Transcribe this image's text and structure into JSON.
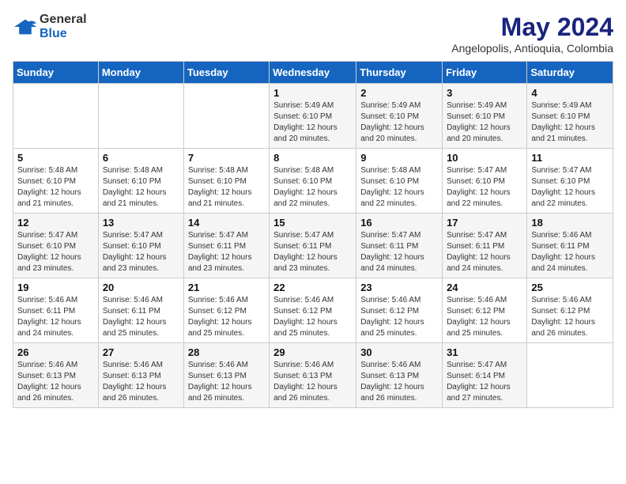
{
  "header": {
    "logo_general": "General",
    "logo_blue": "Blue",
    "month_title": "May 2024",
    "location": "Angelopolis, Antioquia, Colombia"
  },
  "weekdays": [
    "Sunday",
    "Monday",
    "Tuesday",
    "Wednesday",
    "Thursday",
    "Friday",
    "Saturday"
  ],
  "weeks": [
    [
      {
        "day": "",
        "sunrise": "",
        "sunset": "",
        "daylight": ""
      },
      {
        "day": "",
        "sunrise": "",
        "sunset": "",
        "daylight": ""
      },
      {
        "day": "",
        "sunrise": "",
        "sunset": "",
        "daylight": ""
      },
      {
        "day": "1",
        "sunrise": "Sunrise: 5:49 AM",
        "sunset": "Sunset: 6:10 PM",
        "daylight": "Daylight: 12 hours and 20 minutes."
      },
      {
        "day": "2",
        "sunrise": "Sunrise: 5:49 AM",
        "sunset": "Sunset: 6:10 PM",
        "daylight": "Daylight: 12 hours and 20 minutes."
      },
      {
        "day": "3",
        "sunrise": "Sunrise: 5:49 AM",
        "sunset": "Sunset: 6:10 PM",
        "daylight": "Daylight: 12 hours and 20 minutes."
      },
      {
        "day": "4",
        "sunrise": "Sunrise: 5:49 AM",
        "sunset": "Sunset: 6:10 PM",
        "daylight": "Daylight: 12 hours and 21 minutes."
      }
    ],
    [
      {
        "day": "5",
        "sunrise": "Sunrise: 5:48 AM",
        "sunset": "Sunset: 6:10 PM",
        "daylight": "Daylight: 12 hours and 21 minutes."
      },
      {
        "day": "6",
        "sunrise": "Sunrise: 5:48 AM",
        "sunset": "Sunset: 6:10 PM",
        "daylight": "Daylight: 12 hours and 21 minutes."
      },
      {
        "day": "7",
        "sunrise": "Sunrise: 5:48 AM",
        "sunset": "Sunset: 6:10 PM",
        "daylight": "Daylight: 12 hours and 21 minutes."
      },
      {
        "day": "8",
        "sunrise": "Sunrise: 5:48 AM",
        "sunset": "Sunset: 6:10 PM",
        "daylight": "Daylight: 12 hours and 22 minutes."
      },
      {
        "day": "9",
        "sunrise": "Sunrise: 5:48 AM",
        "sunset": "Sunset: 6:10 PM",
        "daylight": "Daylight: 12 hours and 22 minutes."
      },
      {
        "day": "10",
        "sunrise": "Sunrise: 5:47 AM",
        "sunset": "Sunset: 6:10 PM",
        "daylight": "Daylight: 12 hours and 22 minutes."
      },
      {
        "day": "11",
        "sunrise": "Sunrise: 5:47 AM",
        "sunset": "Sunset: 6:10 PM",
        "daylight": "Daylight: 12 hours and 22 minutes."
      }
    ],
    [
      {
        "day": "12",
        "sunrise": "Sunrise: 5:47 AM",
        "sunset": "Sunset: 6:10 PM",
        "daylight": "Daylight: 12 hours and 23 minutes."
      },
      {
        "day": "13",
        "sunrise": "Sunrise: 5:47 AM",
        "sunset": "Sunset: 6:10 PM",
        "daylight": "Daylight: 12 hours and 23 minutes."
      },
      {
        "day": "14",
        "sunrise": "Sunrise: 5:47 AM",
        "sunset": "Sunset: 6:11 PM",
        "daylight": "Daylight: 12 hours and 23 minutes."
      },
      {
        "day": "15",
        "sunrise": "Sunrise: 5:47 AM",
        "sunset": "Sunset: 6:11 PM",
        "daylight": "Daylight: 12 hours and 23 minutes."
      },
      {
        "day": "16",
        "sunrise": "Sunrise: 5:47 AM",
        "sunset": "Sunset: 6:11 PM",
        "daylight": "Daylight: 12 hours and 24 minutes."
      },
      {
        "day": "17",
        "sunrise": "Sunrise: 5:47 AM",
        "sunset": "Sunset: 6:11 PM",
        "daylight": "Daylight: 12 hours and 24 minutes."
      },
      {
        "day": "18",
        "sunrise": "Sunrise: 5:46 AM",
        "sunset": "Sunset: 6:11 PM",
        "daylight": "Daylight: 12 hours and 24 minutes."
      }
    ],
    [
      {
        "day": "19",
        "sunrise": "Sunrise: 5:46 AM",
        "sunset": "Sunset: 6:11 PM",
        "daylight": "Daylight: 12 hours and 24 minutes."
      },
      {
        "day": "20",
        "sunrise": "Sunrise: 5:46 AM",
        "sunset": "Sunset: 6:11 PM",
        "daylight": "Daylight: 12 hours and 25 minutes."
      },
      {
        "day": "21",
        "sunrise": "Sunrise: 5:46 AM",
        "sunset": "Sunset: 6:12 PM",
        "daylight": "Daylight: 12 hours and 25 minutes."
      },
      {
        "day": "22",
        "sunrise": "Sunrise: 5:46 AM",
        "sunset": "Sunset: 6:12 PM",
        "daylight": "Daylight: 12 hours and 25 minutes."
      },
      {
        "day": "23",
        "sunrise": "Sunrise: 5:46 AM",
        "sunset": "Sunset: 6:12 PM",
        "daylight": "Daylight: 12 hours and 25 minutes."
      },
      {
        "day": "24",
        "sunrise": "Sunrise: 5:46 AM",
        "sunset": "Sunset: 6:12 PM",
        "daylight": "Daylight: 12 hours and 25 minutes."
      },
      {
        "day": "25",
        "sunrise": "Sunrise: 5:46 AM",
        "sunset": "Sunset: 6:12 PM",
        "daylight": "Daylight: 12 hours and 26 minutes."
      }
    ],
    [
      {
        "day": "26",
        "sunrise": "Sunrise: 5:46 AM",
        "sunset": "Sunset: 6:13 PM",
        "daylight": "Daylight: 12 hours and 26 minutes."
      },
      {
        "day": "27",
        "sunrise": "Sunrise: 5:46 AM",
        "sunset": "Sunset: 6:13 PM",
        "daylight": "Daylight: 12 hours and 26 minutes."
      },
      {
        "day": "28",
        "sunrise": "Sunrise: 5:46 AM",
        "sunset": "Sunset: 6:13 PM",
        "daylight": "Daylight: 12 hours and 26 minutes."
      },
      {
        "day": "29",
        "sunrise": "Sunrise: 5:46 AM",
        "sunset": "Sunset: 6:13 PM",
        "daylight": "Daylight: 12 hours and 26 minutes."
      },
      {
        "day": "30",
        "sunrise": "Sunrise: 5:46 AM",
        "sunset": "Sunset: 6:13 PM",
        "daylight": "Daylight: 12 hours and 26 minutes."
      },
      {
        "day": "31",
        "sunrise": "Sunrise: 5:47 AM",
        "sunset": "Sunset: 6:14 PM",
        "daylight": "Daylight: 12 hours and 27 minutes."
      },
      {
        "day": "",
        "sunrise": "",
        "sunset": "",
        "daylight": ""
      }
    ]
  ]
}
